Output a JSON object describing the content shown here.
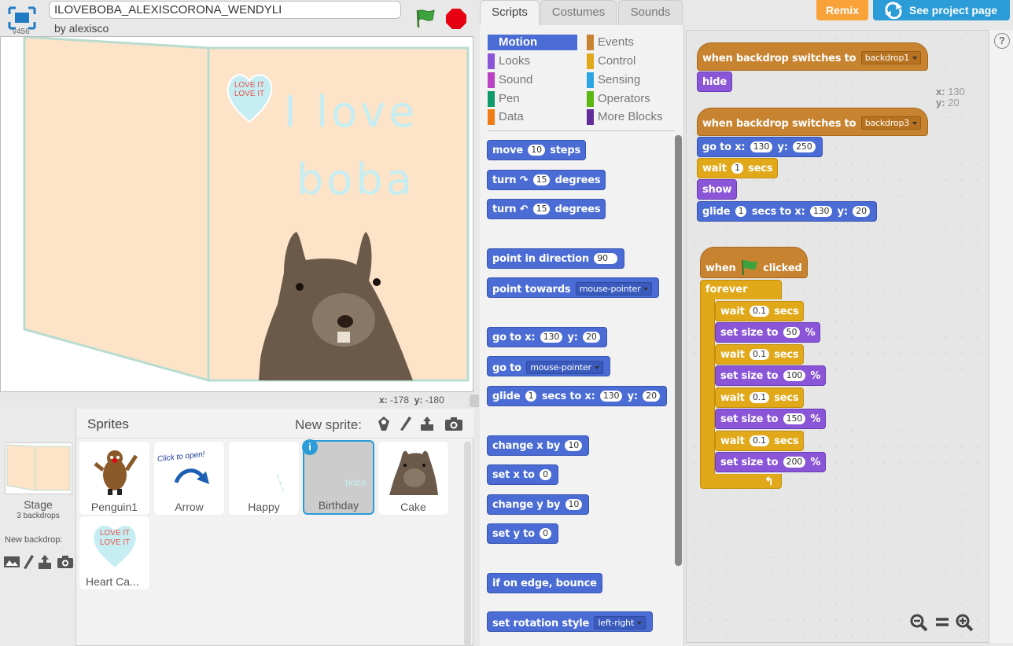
{
  "header": {
    "version": "v456",
    "project_title": "ILOVEBOBA_ALEXISCORONA_WENDYLI",
    "byline": "by alexisco"
  },
  "stage": {
    "love_it_line1": "LOVE IT",
    "love_it_line2": "LOVE IT",
    "text_line1": "I love",
    "text_line2": "boba",
    "mouse_x_label": "x:",
    "mouse_x": "-178",
    "mouse_y_label": "y:",
    "mouse_y": "-180"
  },
  "sprites_panel": {
    "title": "Sprites",
    "new_sprite_label": "New sprite:",
    "stage_label": "Stage",
    "stage_backdrops": "3 backdrops",
    "new_backdrop_label": "New backdrop:",
    "sprites": [
      {
        "name": "Penguin1"
      },
      {
        "name": "Arrow",
        "thumb_text": "Click to open!"
      },
      {
        "name": "Happy"
      },
      {
        "name": "Birthday",
        "thumb_text": "boba",
        "selected": true
      },
      {
        "name": "Cake"
      },
      {
        "name": "Heart Ca...",
        "thumb_text1": "LOVE IT",
        "thumb_text2": "LOVE IT"
      }
    ]
  },
  "tabs": {
    "scripts": "Scripts",
    "costumes": "Costumes",
    "sounds": "Sounds"
  },
  "top_buttons": {
    "remix": "Remix",
    "see_project": "See project page"
  },
  "categories": [
    {
      "name": "Motion",
      "color": "#4a6cd4",
      "active": true
    },
    {
      "name": "Events",
      "color": "#c88330"
    },
    {
      "name": "Looks",
      "color": "#8a55d7"
    },
    {
      "name": "Control",
      "color": "#e1a91a"
    },
    {
      "name": "Sound",
      "color": "#bb42c3"
    },
    {
      "name": "Sensing",
      "color": "#2ca5e2"
    },
    {
      "name": "Pen",
      "color": "#0e9a6c"
    },
    {
      "name": "Operators",
      "color": "#5cb712"
    },
    {
      "name": "Data",
      "color": "#ee7d16"
    },
    {
      "name": "More Blocks",
      "color": "#632d99"
    }
  ],
  "palette_blocks": {
    "move": {
      "a": "move",
      "n": "10",
      "b": "steps"
    },
    "turn_cw": {
      "a": "turn",
      "n": "15",
      "b": "degrees"
    },
    "turn_ccw": {
      "a": "turn",
      "n": "15",
      "b": "degrees"
    },
    "point_dir": {
      "a": "point in direction",
      "n": "90"
    },
    "point_towards": {
      "a": "point towards",
      "d": "mouse-pointer"
    },
    "goto_xy": {
      "a": "go to x:",
      "x": "130",
      "b": "y:",
      "y": "20"
    },
    "goto": {
      "a": "go to",
      "d": "mouse-pointer"
    },
    "glide": {
      "a": "glide",
      "n": "1",
      "b": "secs to x:",
      "x": "130",
      "c": "y:",
      "y": "20"
    },
    "change_x": {
      "a": "change x by",
      "n": "10"
    },
    "set_x": {
      "a": "set x to",
      "n": "0"
    },
    "change_y": {
      "a": "change y by",
      "n": "10"
    },
    "set_y": {
      "a": "set y to",
      "n": "0"
    },
    "bounce": {
      "a": "if on edge, bounce"
    },
    "rotation": {
      "a": "set rotation style",
      "d": "left-right"
    }
  },
  "scripts": {
    "xy_x_label": "x:",
    "xy_x": "130",
    "xy_y_label": "y:",
    "xy_y": "20",
    "s1_hat": {
      "a": "when backdrop switches to",
      "d": "backdrop1"
    },
    "s1_hide": "hide",
    "s2_hat": {
      "a": "when backdrop switches to",
      "d": "backdrop3"
    },
    "s2_goto": {
      "a": "go to x:",
      "x": "130",
      "b": "y:",
      "y": "250"
    },
    "s2_wait": {
      "a": "wait",
      "n": "1",
      "b": "secs"
    },
    "s2_show": "show",
    "s2_glide": {
      "a": "glide",
      "n": "1",
      "b": "secs to x:",
      "x": "130",
      "c": "y:",
      "y": "20"
    },
    "s3_hat": {
      "a": "when",
      "b": "clicked"
    },
    "s3_forever": "forever",
    "s3_wait_a": "wait",
    "s3_wait_b": "secs",
    "s3_wait_n": "0.1",
    "s3_size_a": "set size to",
    "s3_size_b": "%",
    "s3_sizes": [
      "50",
      "100",
      "150",
      "200"
    ]
  }
}
